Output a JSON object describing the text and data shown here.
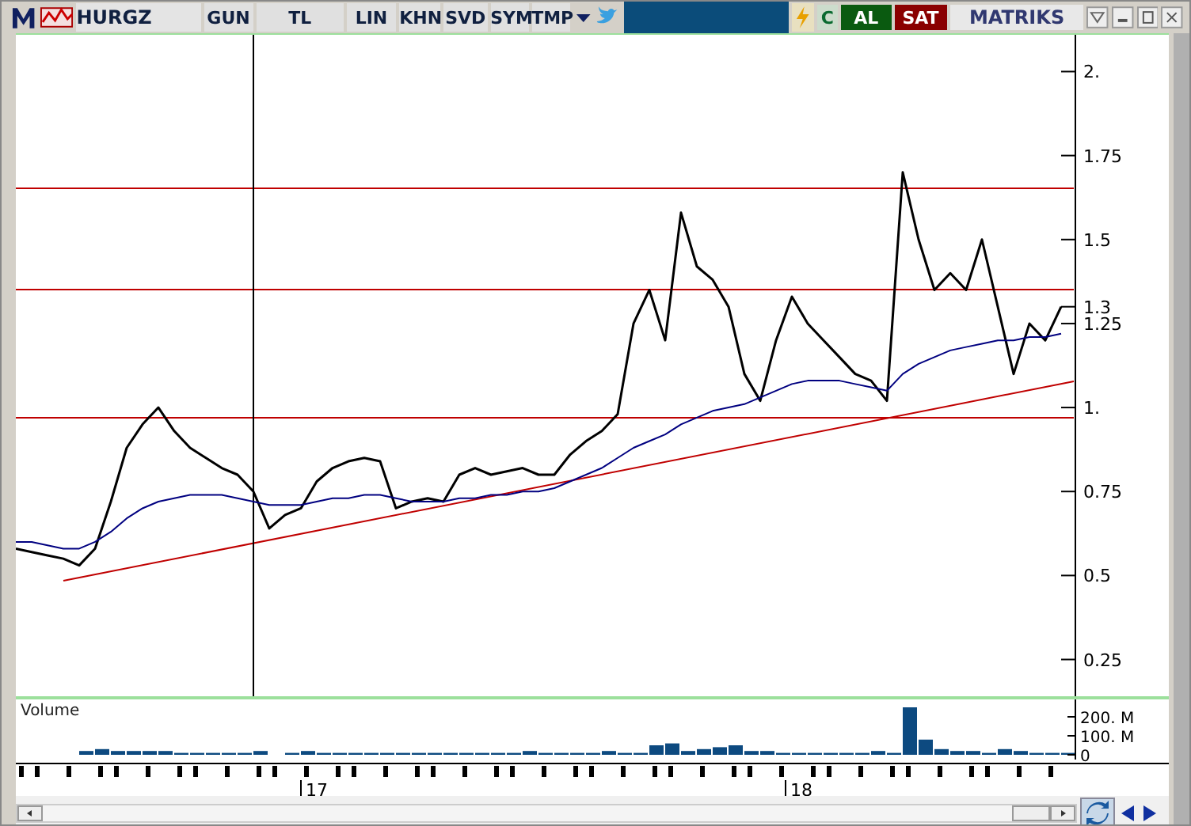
{
  "toolbar": {
    "symbol": "HURGZ",
    "buttons": [
      {
        "label": "GUN"
      },
      {
        "label": "TL"
      },
      {
        "label": "LIN"
      },
      {
        "label": "KHN"
      },
      {
        "label": "SVD"
      },
      {
        "label": "SYM"
      },
      {
        "label": "TMP"
      }
    ],
    "refresh": "C",
    "buy": "AL",
    "sell": "SAT",
    "brand": "MATRIKS"
  },
  "price_panel": {
    "chart_data": {
      "type": "line",
      "ylim": [
        0.15,
        2.1
      ],
      "yticks": [
        {
          "value": 0.25,
          "label": "0.25"
        },
        {
          "value": 0.5,
          "label": "0.5"
        },
        {
          "value": 0.75,
          "label": "0.75"
        },
        {
          "value": 1,
          "label": "1."
        },
        {
          "value": 1.25,
          "label": "1.25"
        },
        {
          "value": 1.3,
          "label": "1.3"
        },
        {
          "value": 1.5,
          "label": "1.5"
        },
        {
          "value": 1.75,
          "label": "1.75"
        },
        {
          "value": 2,
          "label": "2."
        }
      ],
      "series": [
        {
          "color": "#000000",
          "values": [
            0.58,
            0.57,
            0.56,
            0.55,
            0.53,
            0.58,
            0.72,
            0.88,
            0.95,
            1.0,
            0.93,
            0.88,
            0.85,
            0.82,
            0.8,
            0.75,
            0.64,
            0.68,
            0.7,
            0.78,
            0.82,
            0.84,
            0.85,
            0.84,
            0.7,
            0.72,
            0.73,
            0.72,
            0.8,
            0.82,
            0.8,
            0.81,
            0.82,
            0.8,
            0.8,
            0.86,
            0.9,
            0.93,
            0.98,
            1.25,
            1.35,
            1.2,
            1.58,
            1.42,
            1.38,
            1.3,
            1.1,
            1.02,
            1.2,
            1.33,
            1.25,
            1.2,
            1.15,
            1.1,
            1.08,
            1.02,
            1.7,
            1.5,
            1.35,
            1.4,
            1.35,
            1.5,
            1.3,
            1.1,
            1.25,
            1.2,
            1.3
          ]
        },
        {
          "color": "#000080",
          "values": [
            0.6,
            0.6,
            0.59,
            0.58,
            0.58,
            0.6,
            0.63,
            0.67,
            0.7,
            0.72,
            0.73,
            0.74,
            0.74,
            0.74,
            0.73,
            0.72,
            0.71,
            0.71,
            0.71,
            0.72,
            0.73,
            0.73,
            0.74,
            0.74,
            0.73,
            0.72,
            0.72,
            0.72,
            0.73,
            0.73,
            0.74,
            0.74,
            0.75,
            0.75,
            0.76,
            0.78,
            0.8,
            0.82,
            0.85,
            0.88,
            0.9,
            0.92,
            0.95,
            0.97,
            0.99,
            1.0,
            1.01,
            1.03,
            1.05,
            1.07,
            1.08,
            1.08,
            1.08,
            1.07,
            1.06,
            1.05,
            1.1,
            1.13,
            1.15,
            1.17,
            1.18,
            1.19,
            1.2,
            1.2,
            1.21,
            1.21,
            1.22
          ]
        }
      ]
    }
  },
  "volume_panel": {
    "chart_data": {
      "type": "bar",
      "ylim": [
        0,
        300
      ],
      "yticks": [
        {
          "value": 0,
          "label": "0"
        },
        {
          "value": 100,
          "label": "100. M"
        },
        {
          "value": 200,
          "label": "200. M"
        }
      ],
      "series": [
        {
          "name": "Volume",
          "color": "#0d4a80",
          "values": [
            0,
            0,
            0,
            0,
            20,
            30,
            20,
            20,
            20,
            20,
            10,
            10,
            10,
            10,
            10,
            20,
            0,
            10,
            20,
            10,
            10,
            10,
            10,
            10,
            10,
            10,
            10,
            10,
            10,
            10,
            10,
            10,
            20,
            10,
            10,
            10,
            10,
            20,
            10,
            10,
            50,
            60,
            20,
            30,
            40,
            50,
            20,
            20,
            10,
            10,
            10,
            10,
            10,
            10,
            20,
            10,
            250,
            80,
            30,
            20,
            20,
            10,
            30,
            20,
            10,
            10,
            10
          ]
        }
      ]
    }
  },
  "date_axis": {
    "labels": [
      "17",
      "18"
    ]
  }
}
